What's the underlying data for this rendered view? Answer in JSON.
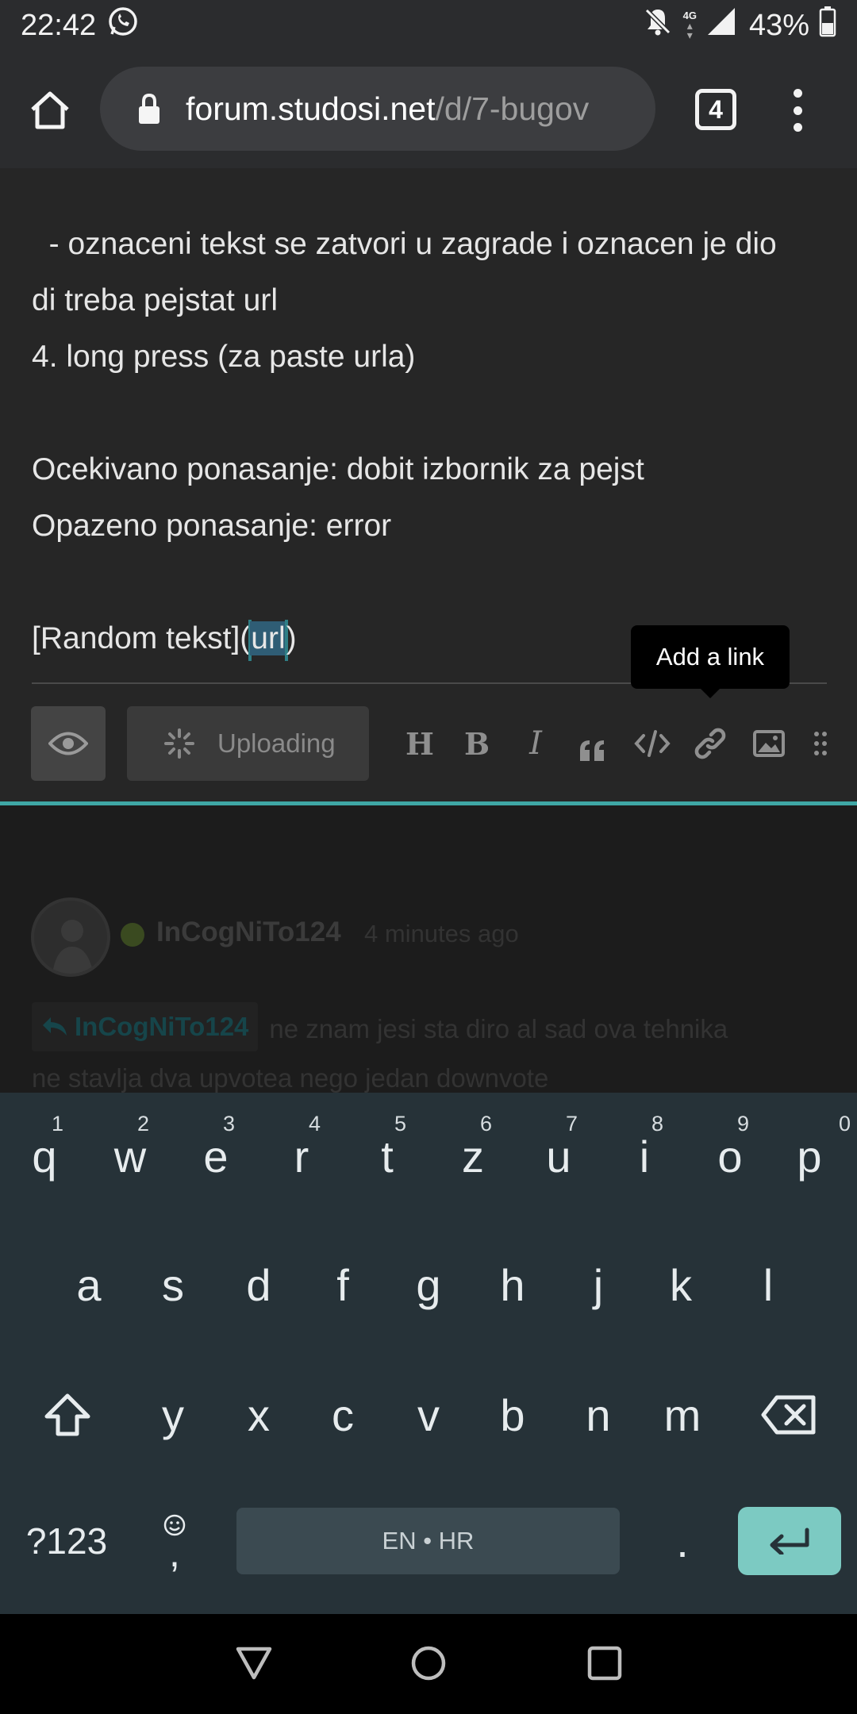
{
  "status_bar": {
    "time": "22:42",
    "network": "4G",
    "battery_percent": "43%",
    "icons": [
      "whatsapp-icon",
      "bell-muted-icon",
      "data-arrows-icon",
      "signal-icon",
      "battery-icon"
    ]
  },
  "browser": {
    "url_host": "forum.studosi.net",
    "url_path": "/d/7-bugov",
    "tab_count": "4"
  },
  "editor": {
    "lines": [
      "  - oznaceni tekst se zatvori u zagrade i oznacen je dio",
      "di treba pejstat url",
      "4. long press (za paste urla)",
      "",
      "Ocekivano ponasanje: dobit izbornik za pejst",
      "Opazeno ponasanje: error",
      ""
    ],
    "last_line_prefix": "[Random tekst](",
    "last_line_selected": "url",
    "last_line_suffix": ")"
  },
  "tooltip": "Add a link",
  "toolbar": {
    "uploading_label": "Uploading",
    "heading": "H",
    "bold": "B",
    "italic": "I"
  },
  "post": {
    "username": "InCogNiTo124",
    "time": "4 minutes ago",
    "reply_to": "InCogNiTo124",
    "body_line1": "ne znam jesi sta diro al sad ova tehnika",
    "body_line2": "ne stavlja dva upvotea nego jedan downvote"
  },
  "keyboard": {
    "row1": [
      "q",
      "w",
      "e",
      "r",
      "t",
      "z",
      "u",
      "i",
      "o",
      "p"
    ],
    "row1_numbers": [
      "1",
      "2",
      "3",
      "4",
      "5",
      "6",
      "7",
      "8",
      "9",
      "0"
    ],
    "row2": [
      "a",
      "s",
      "d",
      "f",
      "g",
      "h",
      "j",
      "k",
      "l"
    ],
    "row3": [
      "y",
      "x",
      "c",
      "v",
      "b",
      "n",
      "m"
    ],
    "symbols_key": "?123",
    "comma_key": ",",
    "space_label": "EN • HR",
    "period_key": "."
  },
  "colors": {
    "accent": "#3fa7a5",
    "enter_key": "#7ccac2",
    "selection": "#2f5d75"
  }
}
